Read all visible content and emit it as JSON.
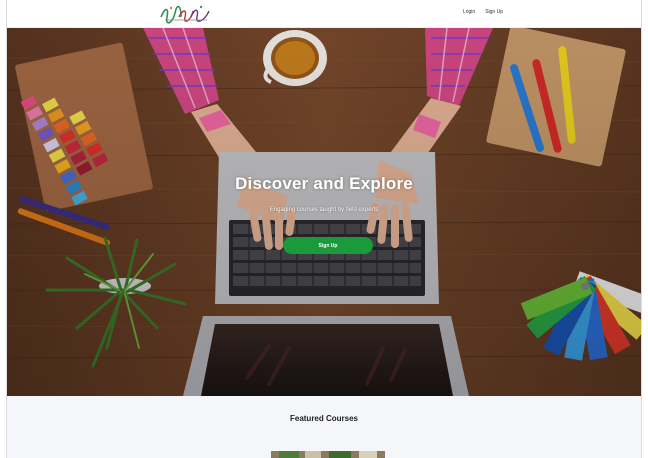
{
  "navbar": {
    "logo_icon": "script-logo-icon",
    "links": [
      {
        "label": "Login"
      },
      {
        "label": "Sign Up"
      }
    ]
  },
  "hero": {
    "title": "Discover and Explore",
    "subtitle": "Engaging courses taught by field experts",
    "cta_label": "Sign Up"
  },
  "featured": {
    "title": "Featured Courses"
  },
  "colors": {
    "cta_green": "#1a9a3a",
    "desk_wood": "#6b4226",
    "featured_bg": "#f5f6fa"
  }
}
